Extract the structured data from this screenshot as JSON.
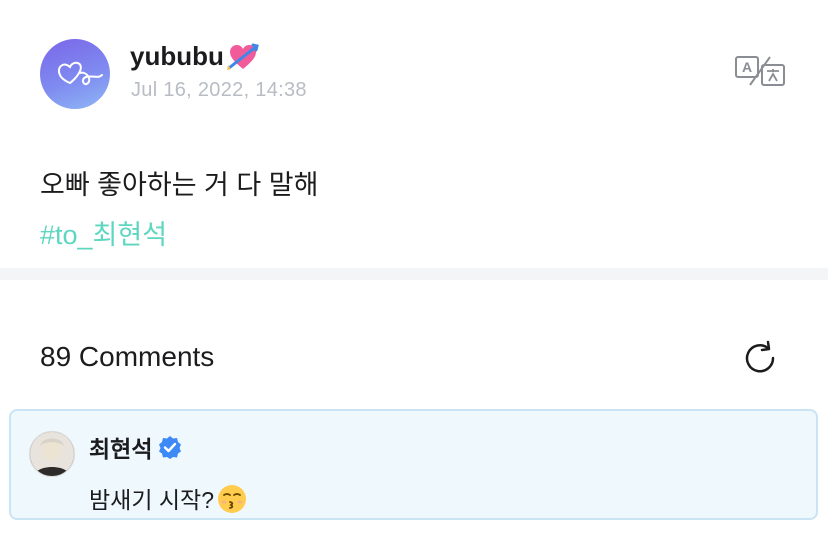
{
  "post": {
    "author": "yububu",
    "author_badge_icon": "heart-with-arrow-icon",
    "timestamp": "Jul 16, 2022, 14:38",
    "text": "오빠 좋아하는 거 다 말해",
    "hashtag": "#to_최현석",
    "translate_icon": "translate-icon"
  },
  "comments": {
    "count_label": "89 Comments",
    "refresh_icon": "refresh-icon",
    "items": [
      {
        "author": "최현석",
        "verified_icon": "verified-badge-icon",
        "text": "밤새기 시작?",
        "emoji_icon": "kissing-face-emoji-icon"
      }
    ]
  },
  "colors": {
    "hashtag": "#5fd6c0",
    "timestamp": "#b8bcc4",
    "highlight_bg": "#eef8fd",
    "highlight_border": "#c9e4f3",
    "verified": "#3d8af7",
    "avatar_gradient_start": "#7a66e8",
    "avatar_gradient_end": "#8fb8f5"
  }
}
